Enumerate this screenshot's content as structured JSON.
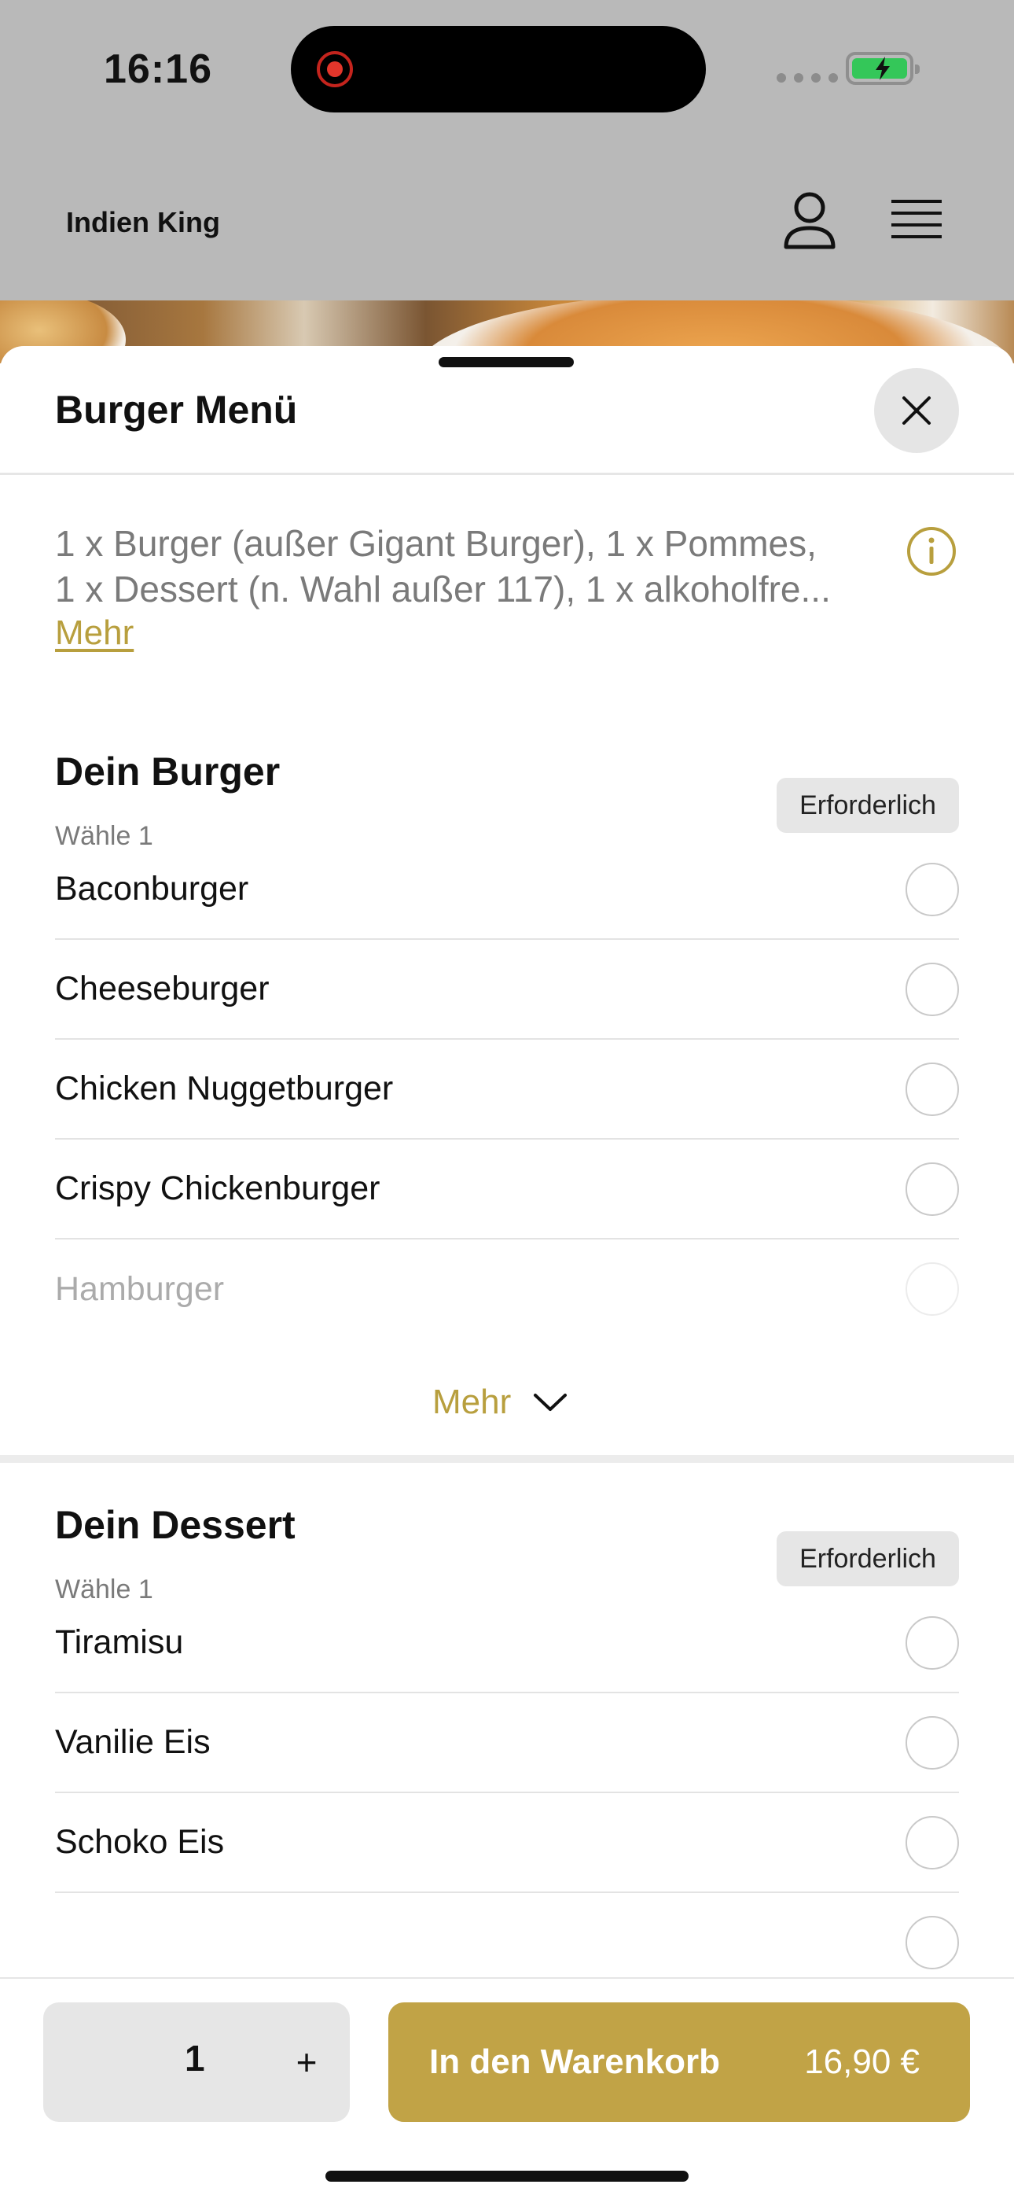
{
  "status_bar": {
    "time": "16:16"
  },
  "header": {
    "brand": "Indien King"
  },
  "sheet": {
    "title": "Burger Menü",
    "description_lines": [
      "1 x Burger (außer Gigant Burger), 1 x Pommes,",
      "1 x Dessert (n. Wahl außer 117), 1 x alkoholfre..."
    ],
    "description_more": "Mehr",
    "groups": [
      {
        "title": "Dein Burger",
        "subtitle": "Wähle 1",
        "badge": "Erforderlich",
        "options": [
          "Baconburger",
          "Cheeseburger",
          "Chicken Nuggetburger",
          "Crispy Chickenburger",
          "Hamburger"
        ],
        "more_label": "Mehr"
      },
      {
        "title": "Dein Dessert",
        "subtitle": "Wähle 1",
        "badge": "Erforderlich",
        "options": [
          "Tiramisu",
          "Vanilie Eis",
          "Schoko Eis"
        ]
      }
    ]
  },
  "bottom_bar": {
    "quantity": "1",
    "plus_label": "+",
    "cart_label": "In den Warenkorb",
    "price": "16,90 €"
  },
  "colors": {
    "accent": "#c1a346",
    "link": "#b89f3e",
    "badge_bg": "#e6e6e6"
  }
}
